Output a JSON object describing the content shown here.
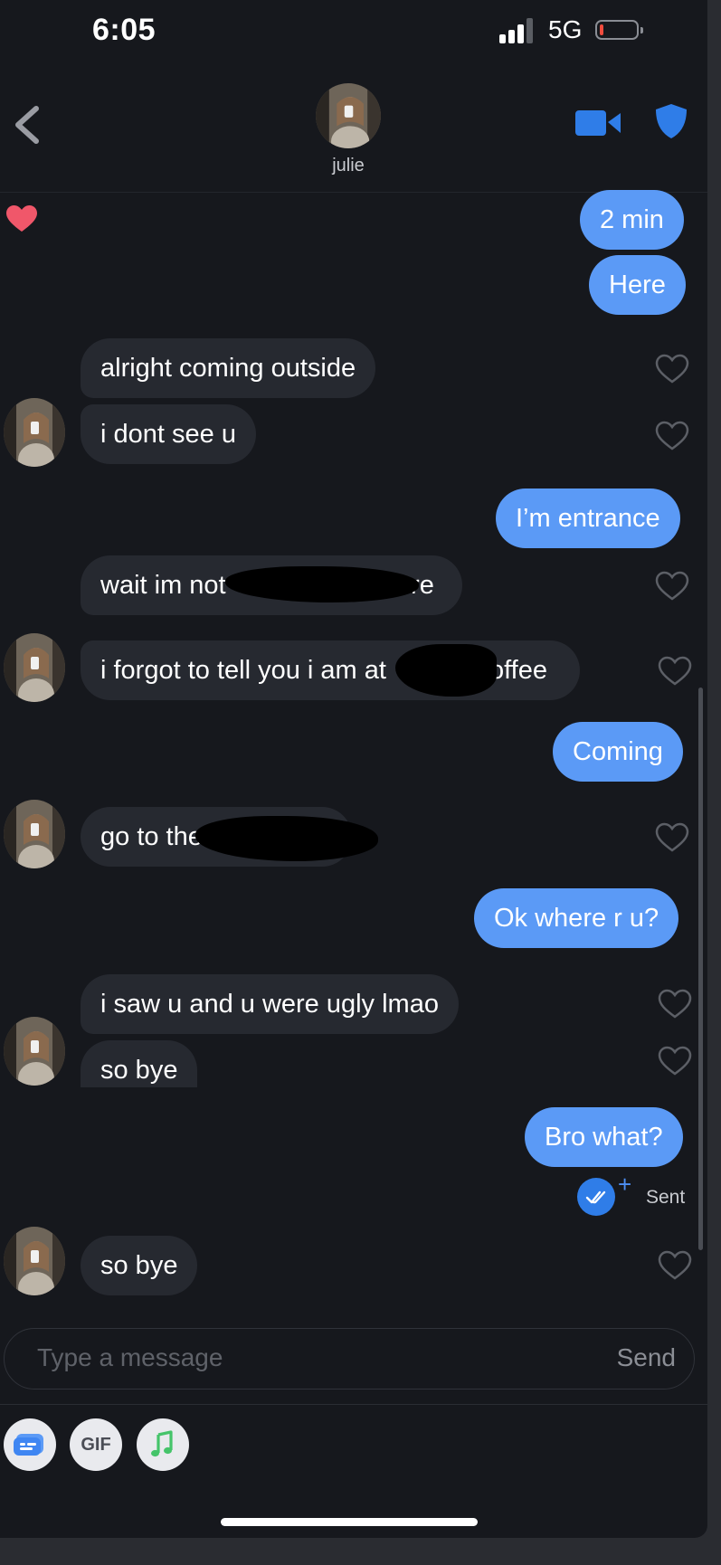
{
  "status_bar": {
    "time": "6:05",
    "network": "5G",
    "battery_level": 0.1
  },
  "header": {
    "contact_name": "julie",
    "icons": {
      "back": "chevron-left-icon",
      "video": "video-camera-icon",
      "safety": "shield-icon"
    }
  },
  "messages": [
    {
      "from": "me",
      "text": "2 min"
    },
    {
      "from": "me",
      "text": "Here"
    },
    {
      "from": "julie",
      "text": "alright coming outside"
    },
    {
      "from": "julie",
      "text": "i dont see u"
    },
    {
      "from": "me",
      "text": "I’m entrance"
    },
    {
      "from": "julie",
      "text": "wait im not",
      "text_after": "anymore"
    },
    {
      "from": "julie",
      "text": "i forgot to tell you i am at",
      "text_after": "offee"
    },
    {
      "from": "me",
      "text": "Coming"
    },
    {
      "from": "julie",
      "text": "go to the"
    },
    {
      "from": "me",
      "text": "Ok where r u?"
    },
    {
      "from": "julie",
      "text": "i saw u and u were ugly lmao"
    },
    {
      "from": "julie",
      "text": "so bye"
    },
    {
      "from": "me",
      "text": "Bro what?"
    },
    {
      "from": "julie",
      "text": "so bye"
    }
  ],
  "receipt": {
    "status": "Sent",
    "plus": "+"
  },
  "composer": {
    "placeholder": "Type a message",
    "send_label": "Send",
    "gif_label": "GIF"
  },
  "colors": {
    "background": "#16181d",
    "outgoing_bubble": "#5b9af6",
    "incoming_bubble": "#262930",
    "accent_blue": "#2f7de8",
    "like_heart": "#f0576a"
  }
}
